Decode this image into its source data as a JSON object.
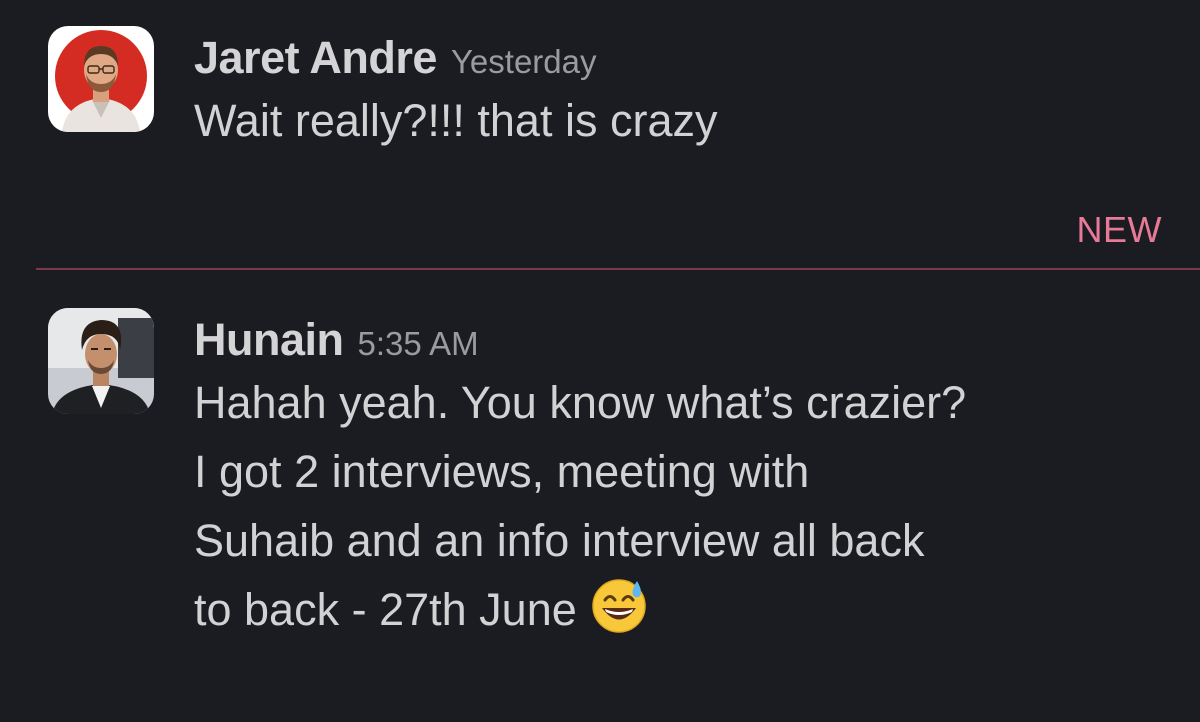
{
  "messages": [
    {
      "author": "Jaret Andre",
      "timestamp": "Yesterday",
      "avatar_icon": "user-avatar-jaret",
      "lines": [
        "Wait really?!!! that is crazy"
      ]
    },
    {
      "author": "Hunain",
      "timestamp": "5:35 AM",
      "avatar_icon": "user-avatar-hunain",
      "lines": [
        "Hahah yeah. You know what’s crazier?",
        "I got 2  interviews, meeting with",
        "Suhaib and an info interview all back",
        "to back - 27th June"
      ],
      "trailing_emoji": "grinning-face-with-sweat-icon"
    }
  ],
  "divider": {
    "label": "NEW",
    "color": "#e77a96"
  },
  "theme": {
    "background": "#1b1c21",
    "text": "#d1d2d3",
    "muted": "#9a9ba0"
  }
}
